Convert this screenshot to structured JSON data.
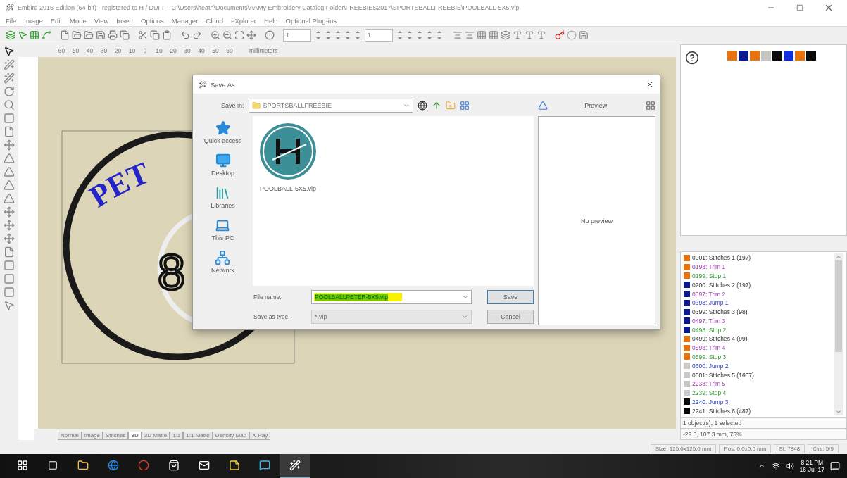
{
  "window": {
    "title": "Embird 2016 Edition (64-bit) - registered to H / DUFF - C:\\Users\\heath\\Documents\\AAMy Embroidery Catalog Folder\\FREEBIES2017\\SPORTSBALLFREEBIE\\POOLBALL-5X5.vip"
  },
  "menu": [
    "File",
    "Image",
    "Edit",
    "Mode",
    "View",
    "Insert",
    "Options",
    "Manager",
    "Cloud",
    "eXplorer",
    "Help",
    "Optional Plug-ins"
  ],
  "toolbar": {
    "field_1": "1",
    "field_2": "1"
  },
  "ruler": {
    "ticks": [
      "-60",
      "-50",
      "-40",
      "-30",
      "-20",
      "-10",
      "0",
      "10",
      "20",
      "30",
      "40",
      "50",
      "60"
    ],
    "unit": "millimeters"
  },
  "palette": [
    {
      "color": "#e8720c"
    },
    {
      "color": "#0b1a8a"
    },
    {
      "color": "#e8720c"
    },
    {
      "color": "#c8c4be"
    },
    {
      "color": "#0a0a0a"
    },
    {
      "color": "#1030e0"
    },
    {
      "color": "#e8720c"
    },
    {
      "color": "#0a0a0a"
    }
  ],
  "design": {
    "arc_text": "PET",
    "number": "8"
  },
  "dialog": {
    "title": "Save As",
    "save_in_label": "Save in:",
    "folder": "SPORTSBALLFREEBIE",
    "places": [
      {
        "label": "Quick access",
        "kind": "star"
      },
      {
        "label": "Desktop",
        "kind": "desktop"
      },
      {
        "label": "Libraries",
        "kind": "libraries"
      },
      {
        "label": "This PC",
        "kind": "pc"
      },
      {
        "label": "Network",
        "kind": "network"
      }
    ],
    "files": [
      {
        "name": "POOLBALL-5X5.vip"
      }
    ],
    "preview_label": "Preview:",
    "no_preview": "No preview",
    "file_name_label": "File name:",
    "file_name": "POOLBALLPETER-5X5.vip",
    "type_label": "Save as type:",
    "type": "*.vip",
    "buttons": [
      "Save",
      "Cancel"
    ]
  },
  "objects": [
    {
      "code": "0001:",
      "label": "Stitches 1 (197)",
      "kind": "stitches",
      "color": "#e8720c"
    },
    {
      "code": "0198:",
      "label": "Trim 1",
      "kind": "trim",
      "color": "#e8720c"
    },
    {
      "code": "0199:",
      "label": "Stop 1",
      "kind": "stop",
      "color": "#e8720c"
    },
    {
      "code": "0200:",
      "label": "Stitches 2 (197)",
      "kind": "stitches",
      "color": "#0b1a8a"
    },
    {
      "code": "0397:",
      "label": "Trim 2",
      "kind": "trim",
      "color": "#0b1a8a"
    },
    {
      "code": "0398:",
      "label": "Jump 1",
      "kind": "jump",
      "color": "#0b1a8a"
    },
    {
      "code": "0399:",
      "label": "Stitches 3 (98)",
      "kind": "stitches",
      "color": "#0b1a8a"
    },
    {
      "code": "0497:",
      "label": "Trim 3",
      "kind": "trim",
      "color": "#0b1a8a"
    },
    {
      "code": "0498:",
      "label": "Stop 2",
      "kind": "stop",
      "color": "#0b1a8a"
    },
    {
      "code": "0499:",
      "label": "Stitches 4 (99)",
      "kind": "stitches",
      "color": "#e8720c"
    },
    {
      "code": "0598:",
      "label": "Trim 4",
      "kind": "trim",
      "color": "#e8720c"
    },
    {
      "code": "0599:",
      "label": "Stop 3",
      "kind": "stop",
      "color": "#e8720c"
    },
    {
      "code": "0600:",
      "label": "Jump 2",
      "kind": "jump",
      "color": "#d4ccc6"
    },
    {
      "code": "0601:",
      "label": "Stitches 5 (1637)",
      "kind": "stitches",
      "color": "#c8c8c8"
    },
    {
      "code": "2238:",
      "label": "Trim 5",
      "kind": "trim",
      "color": "#c8c8c8"
    },
    {
      "code": "2239:",
      "label": "Stop 4",
      "kind": "stop",
      "color": "#c8c8c8"
    },
    {
      "code": "2240:",
      "label": "Jump 3",
      "kind": "jump",
      "color": "#0a0a0a"
    },
    {
      "code": "2241:",
      "label": "Stitches 6 (487)",
      "kind": "stitches",
      "color": "#0a0a0a"
    }
  ],
  "selection_info": "1 object(s), 1 selected",
  "cursor_info": "-29.3, 107.3 mm, 75%",
  "view_tabs": [
    {
      "label": "Normal",
      "selected": false
    },
    {
      "label": "Image",
      "selected": false
    },
    {
      "label": "Stitches",
      "selected": false
    },
    {
      "label": "3D",
      "selected": true
    },
    {
      "label": "3D Matte",
      "selected": false
    },
    {
      "label": "1:1",
      "selected": false
    },
    {
      "label": "1:1 Matte",
      "selected": false
    },
    {
      "label": "Density Map",
      "selected": false
    },
    {
      "label": "X-Ray",
      "selected": false
    }
  ],
  "status_bar": [
    "Size: 125.0x125.0 mm",
    "Pos: 0.0x0.0 mm",
    "St: 7848",
    "Clrs: 5/9"
  ],
  "taskbar": {
    "time": "8:21 PM",
    "date": "16-Jul-17"
  }
}
